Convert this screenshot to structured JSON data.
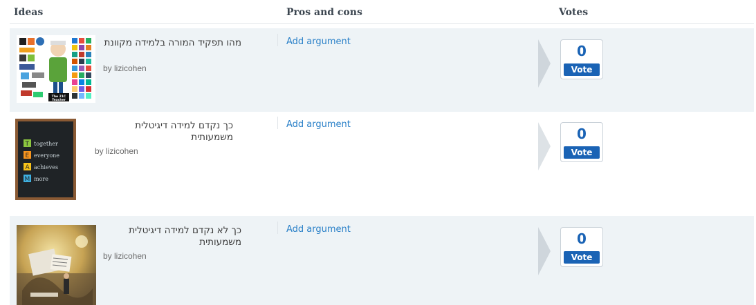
{
  "header": {
    "ideas": "Ideas",
    "pros_cons": "Pros and cons",
    "votes": "Votes"
  },
  "ideas": [
    {
      "title": "מהו תפקיד המורה בלמידה מקוונת",
      "byline": "by lizicohen",
      "add_argument": "Add argument",
      "votes": "0",
      "vote_label": "Vote",
      "thumb_caption": "The 21C Teacher"
    },
    {
      "title": "כך נקדם למידה דיגיטלית משמעותית",
      "byline": "by lizicohen",
      "add_argument": "Add argument",
      "votes": "0",
      "vote_label": "Vote",
      "thumb_words": [
        "together",
        "everyone",
        "achieves",
        "more"
      ]
    },
    {
      "title": "כך לא נקדם למידה דיגיטלית משמעותית",
      "byline": "by lizicohen",
      "add_argument": "Add argument",
      "votes": "0",
      "vote_label": "Vote"
    }
  ],
  "colors": {
    "link": "#2a80c8",
    "vote_blue": "#1a63b5",
    "row_shade": "#eef3f6"
  }
}
